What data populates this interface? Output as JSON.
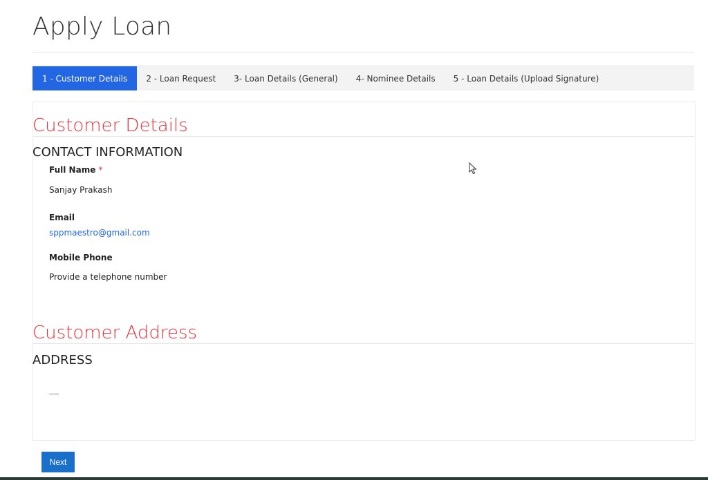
{
  "page": {
    "title": "Apply Loan"
  },
  "tabs": [
    {
      "label": "1 - Customer Details",
      "active": true
    },
    {
      "label": "2 - Loan Request",
      "active": false
    },
    {
      "label": "3- Loan Details (General)",
      "active": false
    },
    {
      "label": "4- Nominee Details",
      "active": false
    },
    {
      "label": "5 - Loan Details (Upload Signature)",
      "active": false
    }
  ],
  "customer_details": {
    "title": "Customer Details",
    "subsection": "CONTACT INFORMATION",
    "full_name": {
      "label": "Full Name",
      "required_marker": "*",
      "value": "Sanjay Prakash"
    },
    "email": {
      "label": "Email",
      "value": "sppmaestro@gmail.com"
    },
    "mobile_phone": {
      "label": "Mobile Phone",
      "value": "Provide a telephone number"
    }
  },
  "customer_address": {
    "title": "Customer Address",
    "subsection": "ADDRESS",
    "value": "—"
  },
  "actions": {
    "next_label": "Next"
  },
  "colors": {
    "accent": "#2266e3",
    "section_title": "#e8323c",
    "button": "#1a6fc9"
  },
  "icons": {
    "cursor": "mouse-pointer-icon"
  }
}
